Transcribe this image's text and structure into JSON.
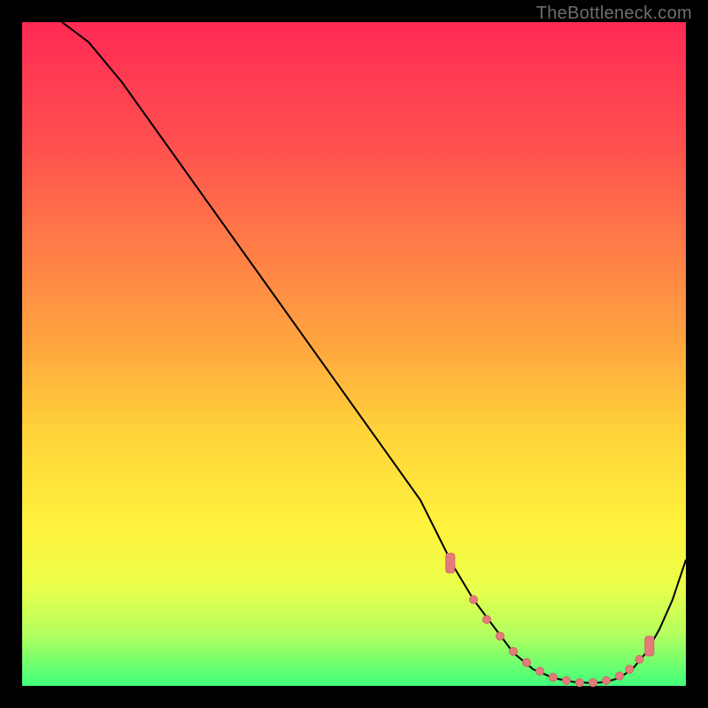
{
  "attribution": "TheBottleneck.com",
  "chart_data": {
    "type": "line",
    "title": "",
    "xlabel": "",
    "ylabel": "",
    "xlim": [
      0,
      100
    ],
    "ylim": [
      0,
      100
    ],
    "grid": false,
    "legend": false,
    "series": [
      {
        "name": "bottleneck-curve",
        "x": [
          6,
          10,
          15,
          20,
          25,
          30,
          35,
          40,
          45,
          50,
          55,
          60,
          63,
          65,
          68,
          71,
          74,
          77,
          80,
          83,
          86,
          88,
          90,
          92,
          94,
          96,
          98,
          100
        ],
        "y": [
          100,
          97,
          91,
          84,
          77,
          70,
          63,
          56,
          49,
          42,
          35,
          28,
          22,
          18,
          13,
          9,
          5,
          2.5,
          1.2,
          0.6,
          0.4,
          0.6,
          1.2,
          2.6,
          5,
          8.5,
          13,
          19
        ]
      }
    ],
    "markers": {
      "name": "highlight-band",
      "points": [
        {
          "x": 64.5,
          "y": 18.5,
          "type": "cap"
        },
        {
          "x": 68,
          "y": 13,
          "type": "dot"
        },
        {
          "x": 70,
          "y": 10,
          "type": "dot"
        },
        {
          "x": 72,
          "y": 7.5,
          "type": "dot"
        },
        {
          "x": 74,
          "y": 5.2,
          "type": "dot"
        },
        {
          "x": 76,
          "y": 3.5,
          "type": "dot"
        },
        {
          "x": 78,
          "y": 2.2,
          "type": "dot"
        },
        {
          "x": 80,
          "y": 1.3,
          "type": "dot"
        },
        {
          "x": 82,
          "y": 0.8,
          "type": "dot"
        },
        {
          "x": 84,
          "y": 0.5,
          "type": "dot"
        },
        {
          "x": 86,
          "y": 0.5,
          "type": "dot"
        },
        {
          "x": 88,
          "y": 0.8,
          "type": "dot"
        },
        {
          "x": 90,
          "y": 1.5,
          "type": "dot"
        },
        {
          "x": 91.5,
          "y": 2.5,
          "type": "dot"
        },
        {
          "x": 93,
          "y": 4.0,
          "type": "dot"
        },
        {
          "x": 94.5,
          "y": 6.0,
          "type": "cap"
        }
      ]
    }
  }
}
